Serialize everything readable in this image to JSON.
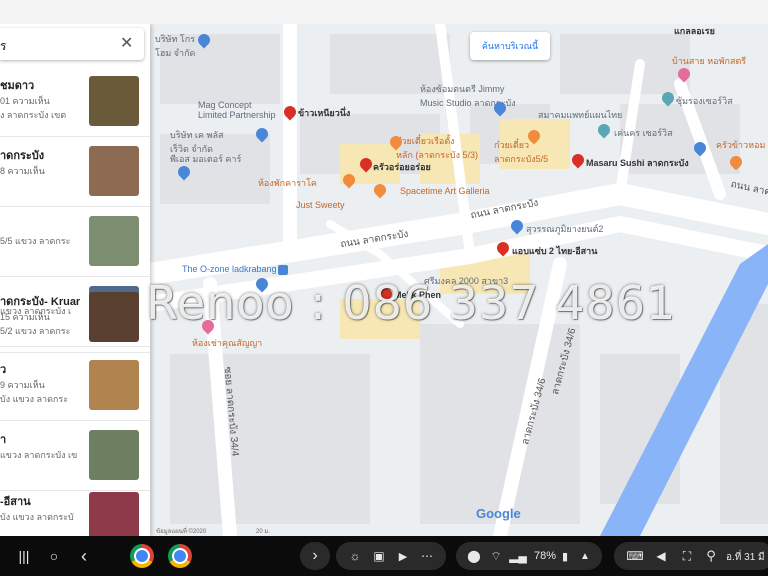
{
  "map": {
    "search_area_button": "ค้นหาบริเวณนี้",
    "places": [
      {
        "name": "บริษัท โกร\nโฮม จำกัด",
        "type": "poi"
      },
      {
        "name": "Mag Concept\nLimited Partnership",
        "type": "poi"
      },
      {
        "name": "ข้าวเหนียวนึ่ง",
        "type": "dark"
      },
      {
        "name": "บริษัท เค พลัส\nเร็วิด จำกัด",
        "type": "poi"
      },
      {
        "name": "พีเอส มอเตอร์ คาร์",
        "type": "poi"
      },
      {
        "name": "ห้องซ้อมดนตรี Jimmy\nMusic Studio ลาดกระบัง",
        "type": "poi"
      },
      {
        "name": "ก๋วยเตี๋ยวเรือตั้ง\nหลัก (ลาดกระบัง 5/3)",
        "type": "food"
      },
      {
        "name": "ก๋วยเตี๋ยว\nลาดกระบัง5/5",
        "type": "food"
      },
      {
        "name": "สมาคมแพทย์แผนไทย",
        "type": "poi"
      },
      {
        "name": "เค่นคร เซอร์วิส",
        "type": "poi"
      },
      {
        "name": "Masaru Sushi ลาดกระบัง",
        "type": "dark"
      },
      {
        "name": "ครัวอร่อยอร่อย",
        "type": "dark"
      },
      {
        "name": "ห้องพักคาราโค",
        "type": "food"
      },
      {
        "name": "Just Sweety",
        "type": "food"
      },
      {
        "name": "Spacetime Art Galleria",
        "type": "food"
      },
      {
        "name": "สุวรรณภูมิยางยนต์2",
        "type": "poi"
      },
      {
        "name": "แอบแซ่บ 2 ไทย-อีสาน",
        "type": "dark"
      },
      {
        "name": "The O-zone ladkrabang",
        "type": "blue"
      },
      {
        "name": "ศรีมงคล 2000 สาขา3",
        "type": "poi"
      },
      {
        "name": "บ้านสาย หอพักสตรี",
        "type": "food"
      },
      {
        "name": "ซุ้มรองเซอร์วิส",
        "type": "poi"
      },
      {
        "name": "ครัวข้าวหอม",
        "type": "food"
      },
      {
        "name": "ห้องเช่าคุณสัญญา",
        "type": "food"
      },
      {
        "name": "Mekk Phen",
        "type": "dark"
      },
      {
        "name": "แกลลอเรย",
        "type": "dark"
      }
    ],
    "roads": [
      "ถนน ลาดกระบัง",
      "ถนน ลาดกระบัง",
      "ถนน ลาดกระบัง",
      "ซอย ลาดกระบัง 34/4",
      "ลาดกระบัง 34/6",
      "ลาดกระบัง 34/6"
    ],
    "google_logo": "Google",
    "copyright": "ข้อมูลแผนที่ ©2020",
    "scale": "20 ม."
  },
  "sidebar": {
    "search_query": "ร",
    "results": [
      {
        "title": "ชมดาว",
        "line2": "01 ความเห็น",
        "line3": "ง ลาดกระบัง เขต",
        "thumb": "#6b5a3a"
      },
      {
        "title": "าดกระบัง",
        "line2": "8 ความเห็น",
        "line3": "",
        "thumb": "#8d6b52"
      },
      {
        "title": "",
        "line2": "5/5 แขวง ลาดกระ",
        "line3": "",
        "thumb": "#7d8d6f"
      },
      {
        "title": "",
        "line2": "แขวง ลาดกระบัง เ",
        "line3": "",
        "thumb": "#4f6a8a"
      },
      {
        "title": "าดกระบัง- Kruar",
        "line2": "15 ความเห็น",
        "line3": "5/2 แขวง ลาดกระ",
        "thumb": "#5a4030"
      },
      {
        "title": "ว",
        "line2": "9 ความเห็น",
        "line3": "บัง แขวง ลาดกระ",
        "thumb": "#b0834f"
      },
      {
        "title": "า",
        "line2": "แขวง ลาดกระบัง เข",
        "line3": "",
        "thumb": "#6f7f62"
      },
      {
        "title": "-อีสาน",
        "line2": "บัง แขวง ลาดกระบั",
        "line3": "",
        "thumb": "#8f3a4a"
      }
    ]
  },
  "watermark": "Renoo : 086 337 4861",
  "taskbar": {
    "battery": "78%",
    "date": "อ.ที่ 31 มี"
  },
  "colors": {
    "road": "#ffffff",
    "map_bg": "#eceff1",
    "water": "#8ab4f8",
    "building": "#e0e2e5",
    "yellow_block": "#f6e7b5"
  }
}
